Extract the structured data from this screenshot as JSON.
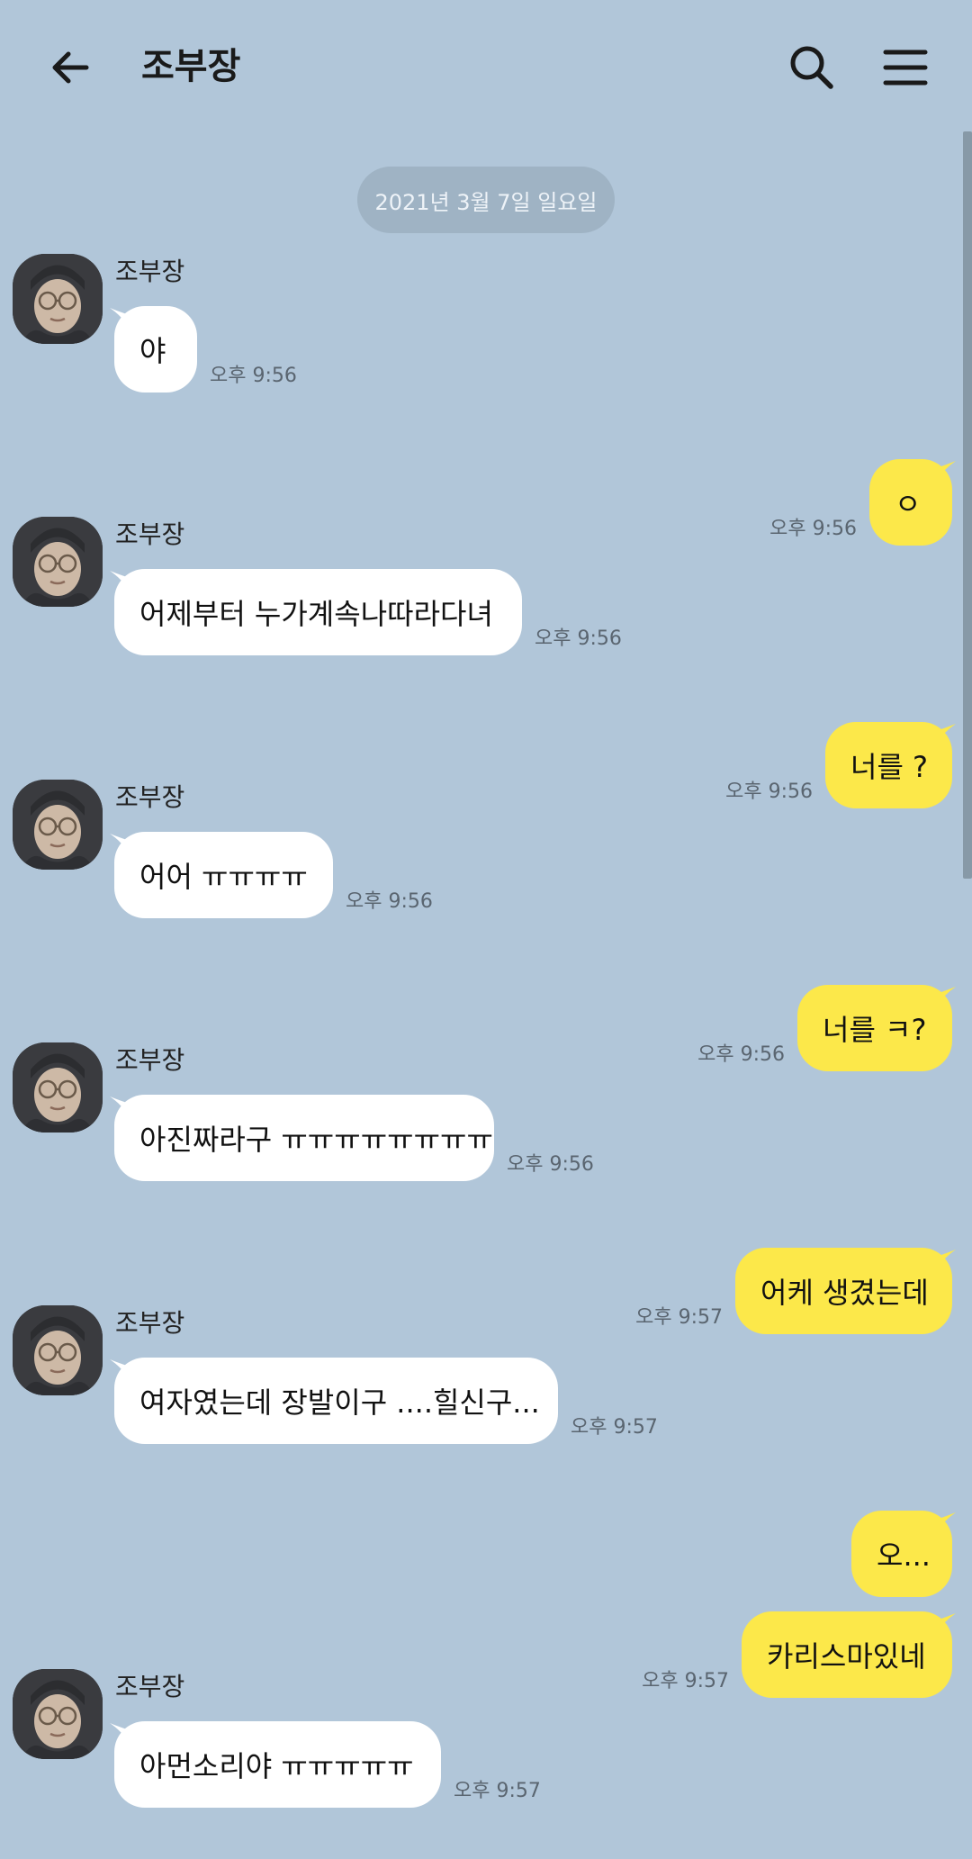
{
  "header": {
    "title": "조부장",
    "back_icon": "back-arrow-icon",
    "search_icon": "search-icon",
    "menu_icon": "hamburger-menu-icon"
  },
  "date_divider": "2021년 3월 7일 일요일",
  "messages": [
    {
      "direction": "in",
      "sender": "조부장",
      "text": "야",
      "time": "오후 9:56"
    },
    {
      "direction": "out",
      "text": "ㅇ",
      "time": "오후 9:56"
    },
    {
      "direction": "in",
      "sender": "조부장",
      "text": "어제부터 누가계속나따라다녀",
      "time": "오후 9:56"
    },
    {
      "direction": "out",
      "text": "너를 ?",
      "time": "오후 9:56"
    },
    {
      "direction": "in",
      "sender": "조부장",
      "text": "어어 ㅠㅠㅠㅠ",
      "time": "오후 9:56"
    },
    {
      "direction": "out",
      "text": "너를 ㅋ?",
      "time": "오후 9:56"
    },
    {
      "direction": "in",
      "sender": "조부장",
      "text": "아진짜라구 ㅠㅠㅠㅠㅠㅠㅠㅠ",
      "time": "오후 9:56"
    },
    {
      "direction": "out",
      "text": "어케 생겼는데",
      "time": "오후 9:57"
    },
    {
      "direction": "in",
      "sender": "조부장",
      "text": "여자였는데 장발이구 ....힐신구...",
      "time": "오후 9:57"
    },
    {
      "direction": "out",
      "text": "오...",
      "time": ""
    },
    {
      "direction": "out",
      "text": "카리스마있네",
      "time": "오후 9:57"
    },
    {
      "direction": "in",
      "sender": "조부장",
      "text": "아먼소리야 ㅠㅠㅠㅠㅠ",
      "time": "오후 9:57"
    }
  ],
  "colors": {
    "background": "#b1c6d9",
    "incoming_bubble": "#ffffff",
    "outgoing_bubble": "#fce84a"
  }
}
